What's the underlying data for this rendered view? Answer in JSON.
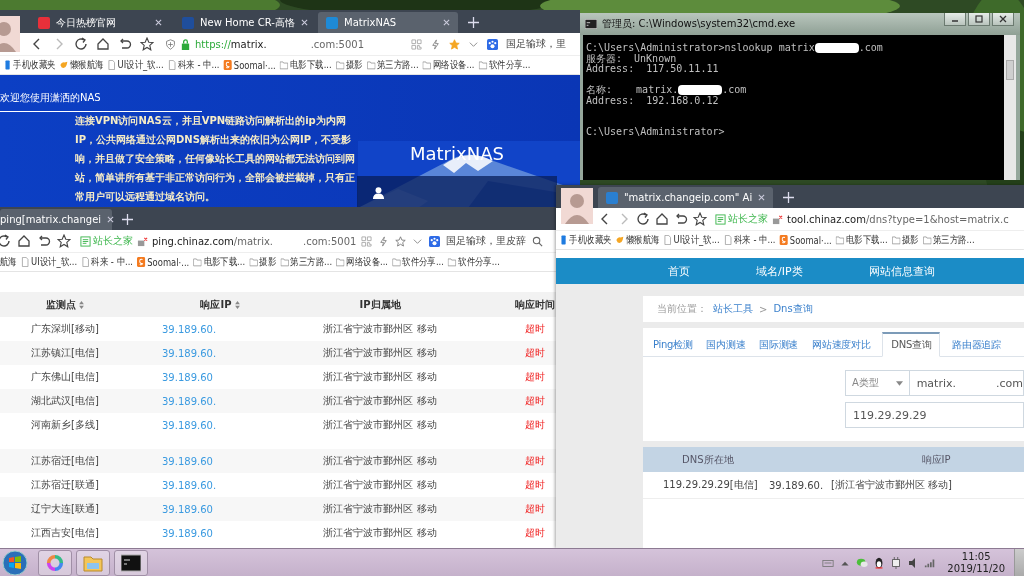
{
  "browsers": [
    {
      "kind": "nas",
      "avatar": true,
      "starred": true,
      "tabs": [
        {
          "title": "今日热榜官网",
          "color": "#e8303a",
          "selected": false
        },
        {
          "title": "New Home CR-高恪",
          "color": "#1f4e9c",
          "selected": false
        },
        {
          "title": "MatrixNAS",
          "color": "#1e8ad6",
          "selected": true
        }
      ],
      "url": {
        "scheme": "https://",
        "main": "matrix.",
        "tail": ".com:5001"
      },
      "search": "国足输球，里",
      "bookmarks": [
        {
          "label": "手机收藏夹",
          "kind": "mobile"
        },
        {
          "label": "懒猴航海",
          "kind": "hand"
        },
        {
          "label": "UI设计_软...",
          "kind": "page"
        },
        {
          "label": "科来 - 中...",
          "kind": "page"
        },
        {
          "label": "Soomal·...",
          "kind": "brand"
        },
        {
          "label": "电影下载...",
          "kind": "folder"
        },
        {
          "label": "摄影",
          "kind": "folder"
        },
        {
          "label": "第三方路...",
          "kind": "folder"
        },
        {
          "label": "网络设备...",
          "kind": "folder"
        },
        {
          "label": "软件分享...",
          "kind": "folder"
        }
      ],
      "page": {
        "welcome": "欢迎您使用潇洒的NAS",
        "notice": "连接VPN访问NAS云，并且VPN链路访问解析出的ip为内网IP，公共网络通过公网DNS解析出来的依旧为公网IP，不受影响，并且做了安全策略，任何像站长工具的网站都无法访问到网站，简单讲所有基于非正常访问行为，全部会被拦截掉，只有正常用户可以远程通过域名访问。",
        "logo": "MatrixNAS"
      }
    },
    {
      "kind": "ping",
      "starred": false,
      "tabs": [
        {
          "title": "ping[matrix.changei",
          "selected": true
        }
      ],
      "url": {
        "badge": "站长之家",
        "main": "ping.chinaz.com",
        "rest": "/matrix.",
        "tail": ".com:5001"
      },
      "search": "国足输球，里皮辞",
      "bookmarks": [
        {
          "label": "航海"
        },
        {
          "label": "UI设计_软...",
          "kind": "page"
        },
        {
          "label": "科来 - 中...",
          "kind": "page"
        },
        {
          "label": "Soomal·...",
          "kind": "brand"
        },
        {
          "label": "电影下载...",
          "kind": "folder"
        },
        {
          "label": "摄影",
          "kind": "folder"
        },
        {
          "label": "第三方路...",
          "kind": "folder"
        },
        {
          "label": "网络设备...",
          "kind": "folder"
        },
        {
          "label": "软件分享...",
          "kind": "folder"
        },
        {
          "label": "软件分享...",
          "kind": "folder"
        }
      ],
      "page": {
        "columns": [
          {
            "label": "监测点",
            "sortable": true
          },
          {
            "label": "响应IP",
            "sortable": true
          },
          {
            "label": "IP归属地",
            "sortable": false
          },
          {
            "label": "响应时间",
            "sortable": false
          }
        ],
        "rows": [
          {
            "site": "广东深圳[移动]",
            "ip": "39.189.60.",
            "location": "浙江省宁波市鄞州区 移动",
            "time": "超时"
          },
          {
            "site": "江苏镇江[电信]",
            "ip": "39.189.60.",
            "location": "浙江省宁波市鄞州区 移动",
            "time": "超时"
          },
          {
            "site": "广东佛山[电信]",
            "ip": "39.189.60",
            "location": "浙江省宁波市鄞州区 移动",
            "time": "超时"
          },
          {
            "site": "湖北武汉[电信]",
            "ip": "39.189.60.",
            "location": "浙江省宁波市鄞州区 移动",
            "time": "超时"
          },
          {
            "site": "河南新乡[多线]",
            "ip": "39.189.60.",
            "location": "浙江省宁波市鄞州区 移动",
            "time": "超时"
          },
          {
            "site": "江苏宿迁[电信]",
            "ip": "39.189.60",
            "location": "浙江省宁波市鄞州区 移动",
            "time": "超时"
          },
          {
            "site": "江苏宿迁[联通]",
            "ip": "39.189.60.",
            "location": "浙江省宁波市鄞州区 移动",
            "time": "超时"
          },
          {
            "site": "辽宁大连[联通]",
            "ip": "39.189.60",
            "location": "浙江省宁波市鄞州区 移动",
            "time": "超时"
          },
          {
            "site": "江西吉安[电信]",
            "ip": "39.189.60",
            "location": "浙江省宁波市鄞州区 移动",
            "time": "超时"
          }
        ]
      }
    },
    {
      "kind": "dns",
      "avatar": true,
      "tabs": [
        {
          "title": "\"matrix.changeip.com\" Ai",
          "color": "#2a7fd0",
          "selected": true
        }
      ],
      "url": {
        "badge": "站长之家",
        "main": "tool.chinaz.com",
        "rest": "/dns?type=1&host=matrix.c"
      },
      "bookmarks": [
        {
          "label": "手机收藏夹",
          "kind": "mobile"
        },
        {
          "label": "懒猴航海",
          "kind": "hand"
        },
        {
          "label": "UI设计_软...",
          "kind": "page"
        },
        {
          "label": "科来 - 中...",
          "kind": "page"
        },
        {
          "label": "Soomal·...",
          "kind": "brand"
        },
        {
          "label": "电影下载...",
          "kind": "folder"
        },
        {
          "label": "摄影",
          "kind": "folder"
        },
        {
          "label": "第三方路...",
          "kind": "folder"
        }
      ],
      "page": {
        "nav": [
          "首页",
          "域名/IP类",
          "网站信息查询"
        ],
        "breadcrumb": {
          "label": "当前位置：",
          "links": [
            "站长工具",
            "Dns查询"
          ],
          "separator": ">"
        },
        "tabs": [
          {
            "label": "Ping检测",
            "selected": false
          },
          {
            "label": "国内测速",
            "selected": false
          },
          {
            "label": "国际测速",
            "selected": false
          },
          {
            "label": "网站速度对比",
            "selected": false
          },
          {
            "label": "DNS查询",
            "selected": true
          },
          {
            "label": "路由器追踪",
            "selected": false
          }
        ],
        "form": {
          "record_type": "A类型",
          "host_start": "matrix.",
          "host_end": ".com",
          "server": "119.29.29.29"
        },
        "table": {
          "columns": [
            "DNS所在地",
            "响应IP"
          ],
          "rows": [
            {
              "location": "119.29.29.29[电信]",
              "ip": "39.189.60.",
              "region": "[浙江省宁波市鄞州区 移动]"
            }
          ]
        }
      }
    }
  ],
  "console": {
    "title": "管理员: C:\\Windows\\system32\\cmd.exe",
    "blocks": [
      [
        {
          "text": "C:\\Users\\Administrator>nslookup matrix",
          "tail": ".com"
        },
        {
          "text": "服务器:  UnKnown"
        },
        {
          "text": "Address:  117.50.11.11"
        }
      ],
      [
        {
          "text": "名称:    matrix.",
          "tail": ".com"
        },
        {
          "text": "Address:  192.168.0.12"
        }
      ],
      [
        {
          "text": "C:\\Users\\Administrator>"
        }
      ]
    ]
  },
  "taskbar": {
    "time": "11:05",
    "date": "2019/11/20"
  }
}
